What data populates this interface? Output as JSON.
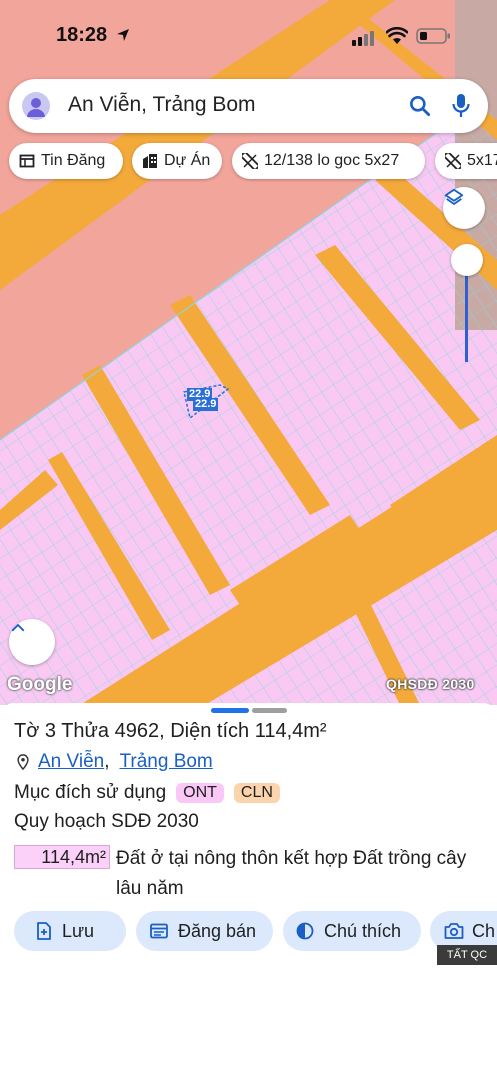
{
  "status_bar": {
    "time": "18:28"
  },
  "search": {
    "query": "An Viễn, Trảng Bom"
  },
  "chips": [
    {
      "label": "Tin Đăng",
      "icon": "listing-icon"
    },
    {
      "label": "Dự Án",
      "icon": "building-icon"
    },
    {
      "label": "12/138 lo goc 5x27",
      "icon": "ruler-icon"
    },
    {
      "label": "5x17",
      "icon": "ruler-icon"
    }
  ],
  "map": {
    "parcel_labels": [
      "22.9",
      "22.9"
    ],
    "google_label": "Google",
    "overlay_label": "QHSDĐ 2030"
  },
  "parcel": {
    "title": "Tờ 3 Thửa 4962, Diện tích 114,4m²",
    "location": {
      "commune": "An Viễn",
      "district": "Trảng Bom"
    },
    "purpose_label": "Mục đích sử dụng",
    "purpose_tags": [
      "ONT",
      "CLN"
    ],
    "plan_label": "Quy hoạch SDĐ 2030",
    "area_value": "114,4m²",
    "area_description": "Đất ở tại nông thôn kết hợp Đất trồng cây lâu năm"
  },
  "actions": [
    {
      "label": "Lưu",
      "icon": "save-icon"
    },
    {
      "label": "Đăng bán",
      "icon": "post-sale-icon"
    },
    {
      "label": "Chú thích",
      "icon": "legend-icon"
    },
    {
      "label": "Ch",
      "icon": "camera-icon"
    }
  ],
  "ads_badge": "TẤT QC",
  "colors": {
    "road": "#f4a93b",
    "residential": "#f9c9f4",
    "salmon_zone": "#f2a59b",
    "parcel_line": "#8fd4dc",
    "accent": "#1e73e8",
    "button_bg": "#dce8fb"
  }
}
